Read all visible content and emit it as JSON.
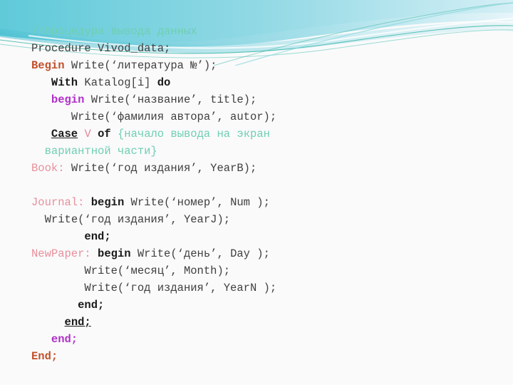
{
  "slide": {
    "background_color": "#FAFAFB",
    "banner": {
      "name": "teal-swoosh-banner",
      "colors": {
        "left": "#5CC8D8",
        "mid": "#7FD4E0",
        "right": "#EAF7FA",
        "line": "#3FB8A8",
        "line_soft": "#8FD8DE"
      }
    }
  },
  "palette": {
    "comment": "#6FCFB0",
    "begin_main": "#C0512B",
    "begin_inner": "#B030C8",
    "keyword": "#1A1A1A",
    "variant_var": "#E8889A",
    "case_label": "#E8909A",
    "body": "#404040"
  },
  "code": {
    "language": "Pascal",
    "lines": [
      {
        "id": "line-comment-header",
        "indent": "",
        "tokens": [
          {
            "name": "comment-text",
            "cls": "t-comment",
            "text": "//процедура вывода данных"
          }
        ]
      },
      {
        "id": "line-procedure-decl",
        "indent": "",
        "tokens": [
          {
            "name": "procedure-declaration",
            "cls": "t-body",
            "text": "Procedure Vivod_data;"
          }
        ]
      },
      {
        "id": "line-begin-main",
        "indent": "",
        "tokens": [
          {
            "name": "begin-keyword-main",
            "cls": "t-beginmain",
            "text": "Begin"
          },
          {
            "name": "write-literatura-call",
            "cls": "t-body",
            "text": " Write(‘литература №’);"
          }
        ]
      },
      {
        "id": "line-with-katalog",
        "indent": "   ",
        "tokens": [
          {
            "name": "with-keyword",
            "cls": "t-kw",
            "text": "With"
          },
          {
            "name": "katalog-expression",
            "cls": "t-body",
            "text": " Katalog[i] "
          },
          {
            "name": "do-keyword",
            "cls": "t-kw",
            "text": "do"
          }
        ]
      },
      {
        "id": "line-begin-inner",
        "indent": "   ",
        "tokens": [
          {
            "name": "begin-keyword-inner",
            "cls": "t-begin",
            "text": "begin"
          },
          {
            "name": "write-nazvanie-call",
            "cls": "t-body",
            "text": " Write(‘название’, title);"
          }
        ]
      },
      {
        "id": "line-write-autor",
        "indent": "      ",
        "tokens": [
          {
            "name": "write-familiya-avtora-call",
            "cls": "t-body",
            "text": "Write(‘фамилия автора’, autor);"
          }
        ]
      },
      {
        "id": "line-case-of",
        "indent": "   ",
        "tokens": [
          {
            "name": "case-keyword",
            "cls": "t-kw-u",
            "text": "Case"
          },
          {
            "name": "case-space-1",
            "cls": "t-body",
            "text": " "
          },
          {
            "name": "variant-selector-v",
            "cls": "t-var",
            "text": "V"
          },
          {
            "name": "case-space-2",
            "cls": "t-body",
            "text": " "
          },
          {
            "name": "of-keyword",
            "cls": "t-kw",
            "text": "of"
          },
          {
            "name": "case-space-3",
            "cls": "t-body",
            "text": " "
          },
          {
            "name": "comment-variant-start",
            "cls": "t-comment",
            "text": "{начало вывода на экран"
          }
        ]
      },
      {
        "id": "line-comment-variant-cont",
        "indent": "  ",
        "tokens": [
          {
            "name": "comment-variant-end",
            "cls": "t-comment",
            "text": "вариантной части}"
          }
        ]
      },
      {
        "id": "line-book-branch",
        "indent": "",
        "tokens": [
          {
            "name": "case-label-book",
            "cls": "t-label",
            "text": "Book:"
          },
          {
            "name": "write-yearb-call",
            "cls": "t-body",
            "text": " Write(‘год издания’, YearB);"
          }
        ]
      },
      {
        "id": "line-blank-1",
        "indent": "",
        "blank": true,
        "tokens": []
      },
      {
        "id": "line-journal-branch",
        "indent": "",
        "tokens": [
          {
            "name": "case-label-journal",
            "cls": "t-label",
            "text": "Journal:"
          },
          {
            "name": "journal-space",
            "cls": "t-body",
            "text": " "
          },
          {
            "name": "begin-keyword-journal",
            "cls": "t-kw",
            "text": "begin"
          },
          {
            "name": "write-nomer-call",
            "cls": "t-body",
            "text": " Write(‘номер’, Num );"
          }
        ]
      },
      {
        "id": "line-journal-yearj",
        "indent": "  ",
        "tokens": [
          {
            "name": "write-yearj-call",
            "cls": "t-body",
            "text": "Write(‘год издания’, YearJ);"
          }
        ]
      },
      {
        "id": "line-end-journal",
        "indent": "        ",
        "tokens": [
          {
            "name": "end-keyword-journal",
            "cls": "t-kw",
            "text": "end;"
          }
        ]
      },
      {
        "id": "line-newpaper-branch",
        "indent": "",
        "tokens": [
          {
            "name": "case-label-newpaper",
            "cls": "t-label",
            "text": "NewPaper:"
          },
          {
            "name": "newpaper-space",
            "cls": "t-body",
            "text": " "
          },
          {
            "name": "begin-keyword-newpaper",
            "cls": "t-kw",
            "text": "begin"
          },
          {
            "name": "write-den-call",
            "cls": "t-body",
            "text": " Write(‘день’, Day );"
          }
        ]
      },
      {
        "id": "line-newpaper-month",
        "indent": "        ",
        "tokens": [
          {
            "name": "write-mesyac-call",
            "cls": "t-body",
            "text": "Write(‘месяц’, Month);"
          }
        ]
      },
      {
        "id": "line-newpaper-yearn",
        "indent": "        ",
        "tokens": [
          {
            "name": "write-yearn-call",
            "cls": "t-body",
            "text": "Write(‘год издания’, YearN );"
          }
        ]
      },
      {
        "id": "line-end-newpaper",
        "indent": "       ",
        "tokens": [
          {
            "name": "end-keyword-newpaper",
            "cls": "t-kw",
            "text": "end;"
          }
        ]
      },
      {
        "id": "line-end-case",
        "indent": "     ",
        "tokens": [
          {
            "name": "end-keyword-case",
            "cls": "t-kw-u",
            "text": "end;"
          }
        ]
      },
      {
        "id": "line-end-with",
        "indent": "   ",
        "tokens": [
          {
            "name": "end-keyword-with",
            "cls": "t-begin",
            "text": "end;"
          }
        ]
      },
      {
        "id": "line-end-procedure",
        "indent": "",
        "tokens": [
          {
            "name": "end-keyword-procedure",
            "cls": "t-beginmain",
            "text": "End;"
          }
        ]
      }
    ]
  }
}
